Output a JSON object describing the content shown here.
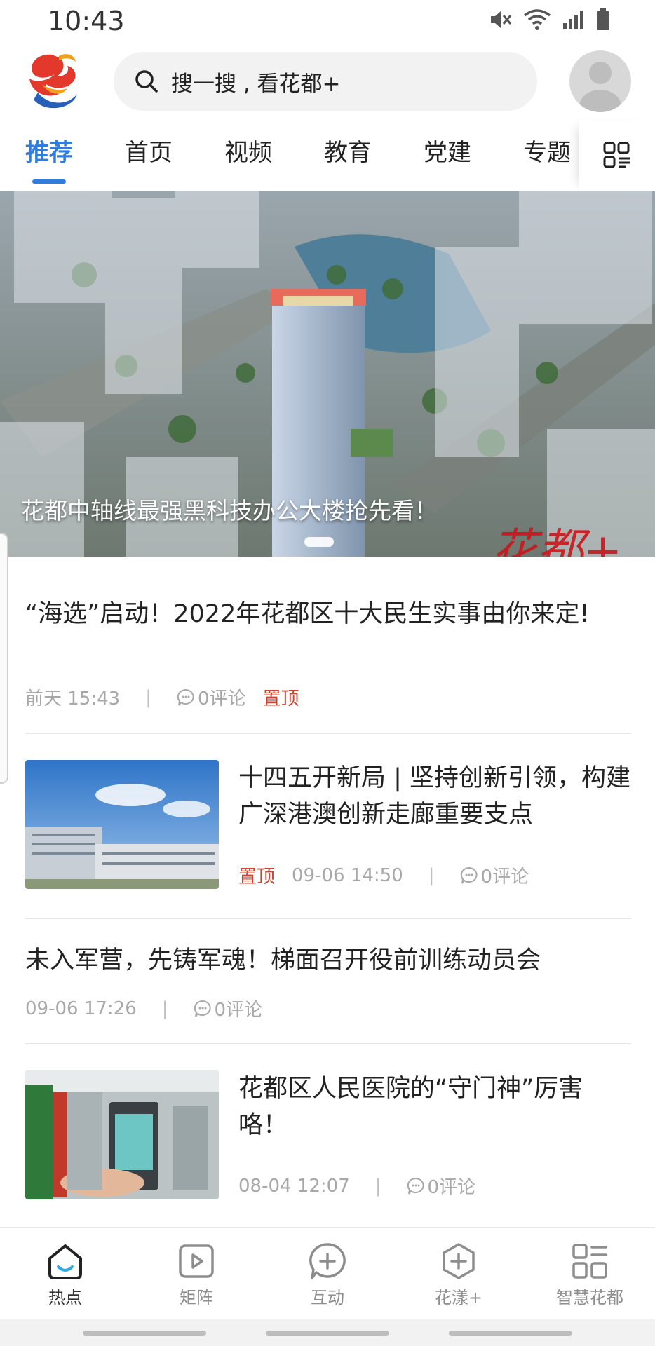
{
  "status_bar": {
    "time": "10:43",
    "icons": [
      "mute-icon",
      "wifi-icon",
      "signal-icon",
      "battery-icon"
    ]
  },
  "header": {
    "logo": "huadu-logo",
    "search_placeholder": "搜一搜 , 看花都+",
    "avatar": "user-avatar"
  },
  "tabs": {
    "items": [
      "推荐",
      "首页",
      "视频",
      "教育",
      "党建",
      "专题"
    ],
    "active_index": 0,
    "accent_color": "#2f7de1",
    "more_icon": "grid-menu-icon"
  },
  "banner": {
    "caption": "花都中轴线最强黑科技办公大楼抢先看！",
    "watermark": "花都+"
  },
  "feed": [
    {
      "title": "“海选”启动！2022年花都区十大民生实事由你来定!",
      "time": "前天 15:43",
      "comments": "0评论",
      "pinned_label": "置顶"
    },
    {
      "title": "十四五开新局 | 坚持创新引领，构建广深港澳创新走廊重要支点",
      "pinned_label": "置顶",
      "time": "09-06 14:50",
      "comments": "0评论",
      "thumbnail": "office-buildings-photo"
    },
    {
      "title": "未入军营，先铸军魂！梯面召开役前训练动员会",
      "time": "09-06 17:26",
      "comments": "0评论"
    },
    {
      "title": "花都区人民医院的“守门神”厉害咯！",
      "time": "08-04 12:07",
      "comments": "0评论",
      "thumbnail": "hospital-entrance-photo"
    }
  ],
  "bottom_nav": {
    "items": [
      {
        "label": "热点",
        "icon": "home-icon",
        "active": true
      },
      {
        "label": "矩阵",
        "icon": "video-icon",
        "active": false
      },
      {
        "label": "互动",
        "icon": "chat-plus-icon",
        "active": false
      },
      {
        "label": "花漾+",
        "icon": "hexagon-plus-icon",
        "active": false
      },
      {
        "label": "智慧花都",
        "icon": "apps-grid-icon",
        "active": false
      }
    ]
  },
  "colors": {
    "accent": "#2f7de1",
    "pin": "#d2432f",
    "meta": "#a8a8a8"
  }
}
